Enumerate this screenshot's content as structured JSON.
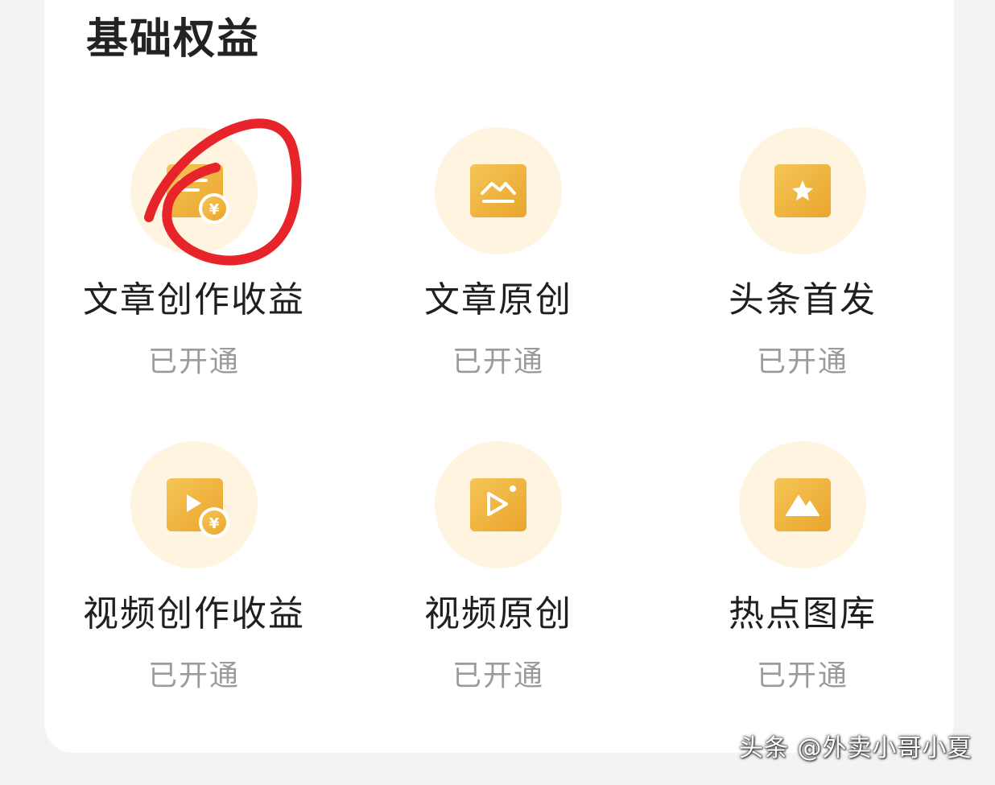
{
  "section": {
    "title": "基础权益"
  },
  "benefits": [
    {
      "name": "文章创作收益",
      "status": "已开通",
      "icon": "article-income-icon"
    },
    {
      "name": "文章原创",
      "status": "已开通",
      "icon": "article-original-icon"
    },
    {
      "name": "头条首发",
      "status": "已开通",
      "icon": "headline-first-icon"
    },
    {
      "name": "视频创作收益",
      "status": "已开通",
      "icon": "video-income-icon"
    },
    {
      "name": "视频原创",
      "status": "已开通",
      "icon": "video-original-icon"
    },
    {
      "name": "热点图库",
      "status": "已开通",
      "icon": "hot-gallery-icon"
    }
  ],
  "watermark": {
    "text": "头条 @外卖小哥小夏"
  },
  "colors": {
    "icon_gold": "#f0b43c",
    "icon_circle_bg": "#fff4e0",
    "annotation_red": "#e8242b",
    "status_gray": "#9b9b9b"
  }
}
